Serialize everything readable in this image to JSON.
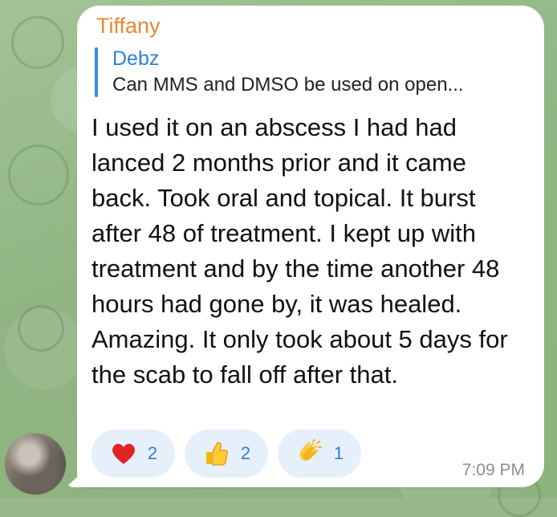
{
  "message": {
    "sender": "Tiffany",
    "reply": {
      "name": "Debz",
      "text": "Can MMS and DMSO be used on open..."
    },
    "body": "I used it on an abscess I had had lanced 2 months prior and it came back. Took oral and topical. It burst after 48 of treatment. I kept up with treatment and by the time another 48 hours had gone by, it was healed. Amazing. It only took about 5 days for the scab to fall off after that.",
    "timestamp": "7:09 PM",
    "reactions": [
      {
        "icon": "heart-icon",
        "count": "2"
      },
      {
        "icon": "thumbs-up-icon",
        "count": "2"
      },
      {
        "icon": "clapping-hands-icon",
        "count": "1"
      }
    ]
  },
  "colors": {
    "sender": "#e8872f",
    "reply_accent": "#3b88e0",
    "reaction_bg": "#e6f0fb",
    "reaction_text": "#2f7fd9"
  }
}
